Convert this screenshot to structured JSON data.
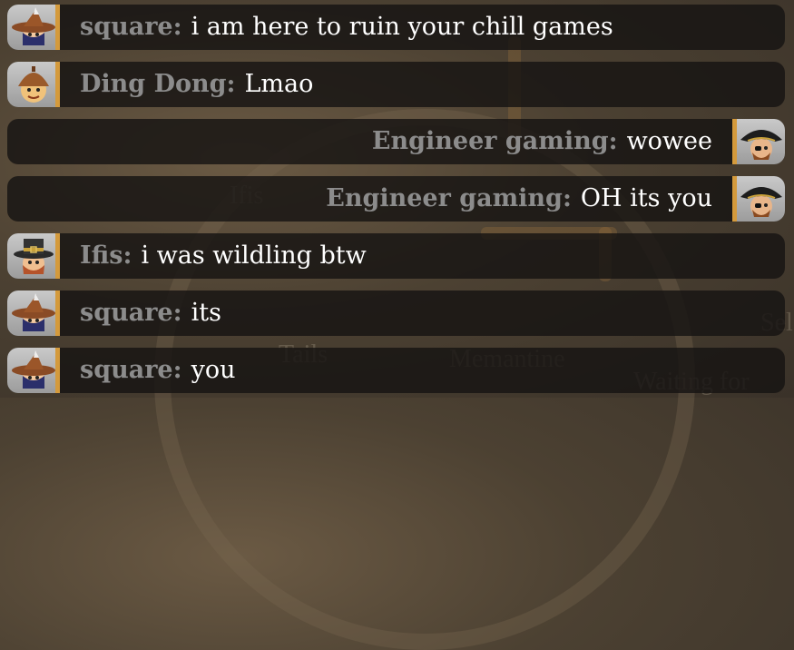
{
  "background": {
    "labels": [
      "Ifis",
      "Tails",
      "Memantine",
      "Sel",
      "Waiting for"
    ]
  },
  "colors": {
    "accent": "#d49a3c",
    "sender": "#8c8c8c",
    "message": "#ffffff",
    "row_bg": "#161412"
  },
  "messages": [
    {
      "sender": "square",
      "text": "i am here to ruin your chill games",
      "side": "left",
      "avatar": "witch-hat-avatar-icon"
    },
    {
      "sender": "Ding Dong",
      "text": "Lmao",
      "side": "left",
      "avatar": "acorn-cap-avatar-icon"
    },
    {
      "sender": "Engineer gaming",
      "text": "wowee",
      "side": "right",
      "avatar": "pirate-avatar-icon"
    },
    {
      "sender": "Engineer gaming",
      "text": "OH its you",
      "side": "right",
      "avatar": "pirate-avatar-icon"
    },
    {
      "sender": "Ifis",
      "text": "i was wildling btw",
      "side": "left",
      "avatar": "pilgrim-hat-avatar-icon"
    },
    {
      "sender": "square",
      "text": "its",
      "side": "left",
      "avatar": "witch-hat-avatar-icon"
    },
    {
      "sender": "square",
      "text": "you",
      "side": "left",
      "avatar": "witch-hat-avatar-icon"
    }
  ]
}
